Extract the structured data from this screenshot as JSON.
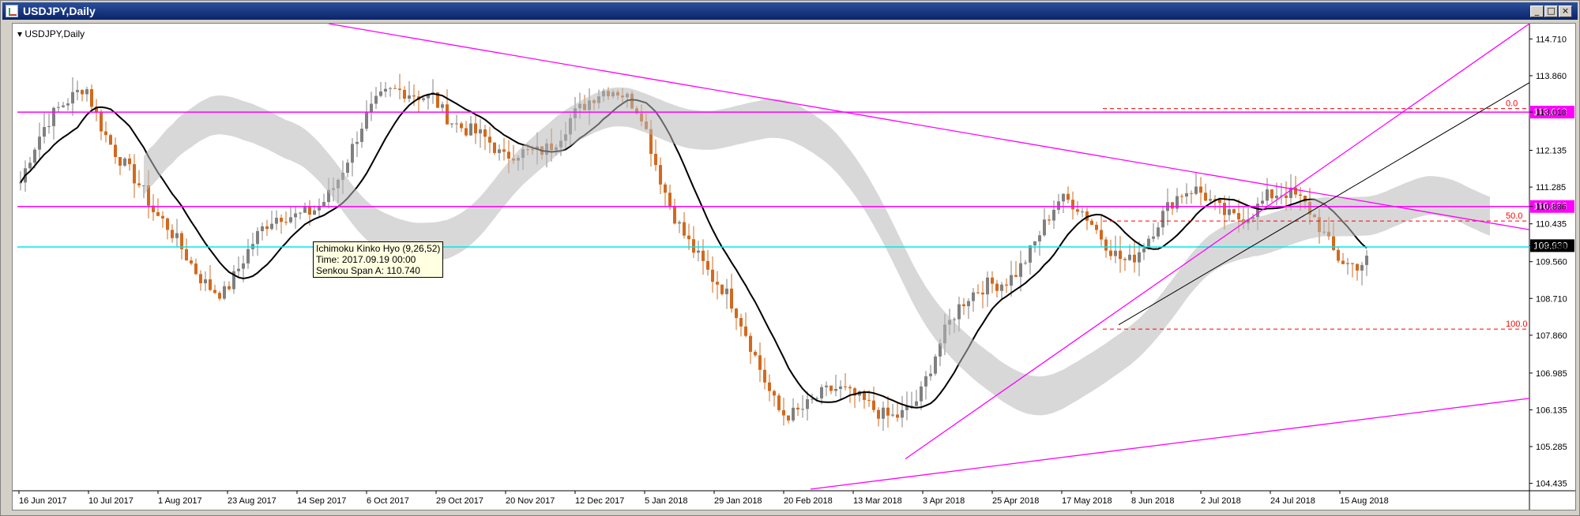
{
  "window": {
    "title": "USDJPY,Daily",
    "controls": {
      "minimize": "_",
      "restore": "□",
      "close": "×"
    }
  },
  "chart": {
    "symbol_label": "USDJPY,Daily",
    "tooltip": {
      "line1": "Ichimoku Kinko Hyo (9,26,52)",
      "line2": "Time: 2017.09.19 00:00",
      "line3": "Senkou Span A: 110.740"
    }
  },
  "colors": {
    "background": "#ffffff",
    "bull_candle": "#808080",
    "bear_candle": "#d2691e",
    "kijun": "#000000",
    "kumo_bull": "#00f0ff",
    "kumo_bear": "#b8b8b8",
    "trendlines": "#ff00ff",
    "fib": "#ff0000",
    "price_marker": "#ff00ff",
    "current_price_marker": "#000000",
    "horizontal_cyan": "#00e5ee"
  },
  "chart_data": {
    "type": "candlestick",
    "symbol": "USDJPY",
    "timeframe": "Daily",
    "indicator": "Ichimoku Kinko Hyo (9,26,52)",
    "ylim": [
      104.435,
      114.71
    ],
    "y_ticks": [
      "114.710",
      "113.860",
      "113.018",
      "112.135",
      "111.285",
      "110.836",
      "110.435",
      "109.930",
      "109.560",
      "108.710",
      "107.860",
      "106.985",
      "106.135",
      "105.285",
      "104.435"
    ],
    "x_ticks": [
      "16 Jun 2017",
      "10 Jul 2017",
      "1 Aug 2017",
      "23 Aug 2017",
      "14 Sep 2017",
      "6 Oct 2017",
      "29 Oct 2017",
      "20 Nov 2017",
      "12 Dec 2017",
      "5 Jan 2018",
      "29 Jan 2018",
      "20 Feb 2018",
      "13 Mar 2018",
      "3 Apr 2018",
      "25 Apr 2018",
      "17 May 2018",
      "8 Jun 2018",
      "2 Jul 2018",
      "24 Jul 2018",
      "15 Aug 2018"
    ],
    "close_series": [
      {
        "date": "16 Jun 2017",
        "close": 111.0
      },
      {
        "date": "10 Jul 2017",
        "close": 114.0
      },
      {
        "date": "1 Aug 2017",
        "close": 110.2
      },
      {
        "date": "23 Aug 2017",
        "close": 109.2
      },
      {
        "date": "14 Sep 2017",
        "close": 110.5
      },
      {
        "date": "6 Oct 2017",
        "close": 112.6
      },
      {
        "date": "29 Oct 2017",
        "close": 113.8
      },
      {
        "date": "20 Nov 2017",
        "close": 111.5
      },
      {
        "date": "12 Dec 2017",
        "close": 113.2
      },
      {
        "date": "5 Jan 2018",
        "close": 113.0
      },
      {
        "date": "29 Jan 2018",
        "close": 108.9
      },
      {
        "date": "20 Feb 2018",
        "close": 106.5
      },
      {
        "date": "13 Mar 2018",
        "close": 106.1
      },
      {
        "date": "3 Apr 2018",
        "close": 106.6
      },
      {
        "date": "25 Apr 2018",
        "close": 109.2
      },
      {
        "date": "17 May 2018",
        "close": 110.6
      },
      {
        "date": "8 Jun 2018",
        "close": 110.0
      },
      {
        "date": "2 Jul 2018",
        "close": 110.9
      },
      {
        "date": "24 Jul 2018",
        "close": 111.1
      },
      {
        "date": "15 Aug 2018",
        "close": 109.93
      }
    ],
    "horizontal_levels": [
      {
        "label": "113.018",
        "value": 113.018,
        "style": "marker"
      },
      {
        "label": "110.836",
        "value": 110.836,
        "style": "marker"
      },
      {
        "label": "109.930",
        "value": 109.93,
        "style": "current"
      },
      {
        "value": 109.9,
        "style": "cyan-line"
      }
    ],
    "fibonacci": [
      {
        "label": "0.0",
        "value": 113.1
      },
      {
        "label": "50.0",
        "value": 110.5
      },
      {
        "label": "100.0",
        "value": 108.0
      }
    ]
  }
}
